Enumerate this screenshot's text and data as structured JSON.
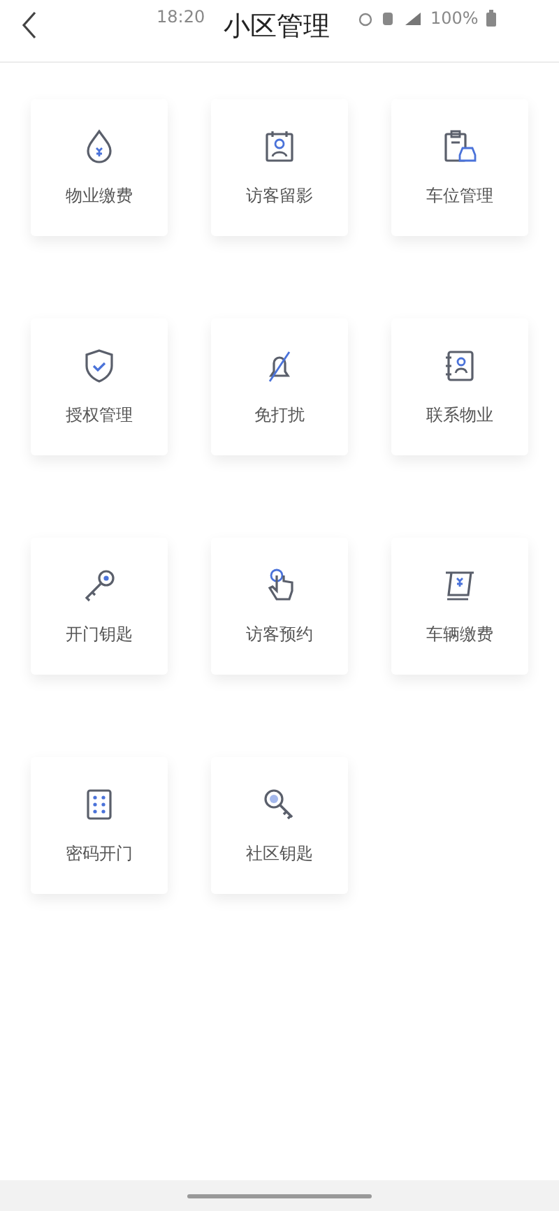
{
  "status_bar": {
    "time": "18:20",
    "battery": "100%"
  },
  "header": {
    "title": "小区管理"
  },
  "tiles": [
    {
      "label": "物业缴费"
    },
    {
      "label": "访客留影"
    },
    {
      "label": "车位管理"
    },
    {
      "label": "授权管理"
    },
    {
      "label": "免打扰"
    },
    {
      "label": "联系物业"
    },
    {
      "label": "开门钥匙"
    },
    {
      "label": "访客预约"
    },
    {
      "label": "车辆缴费"
    },
    {
      "label": "密码开门"
    },
    {
      "label": "社区钥匙"
    }
  ]
}
